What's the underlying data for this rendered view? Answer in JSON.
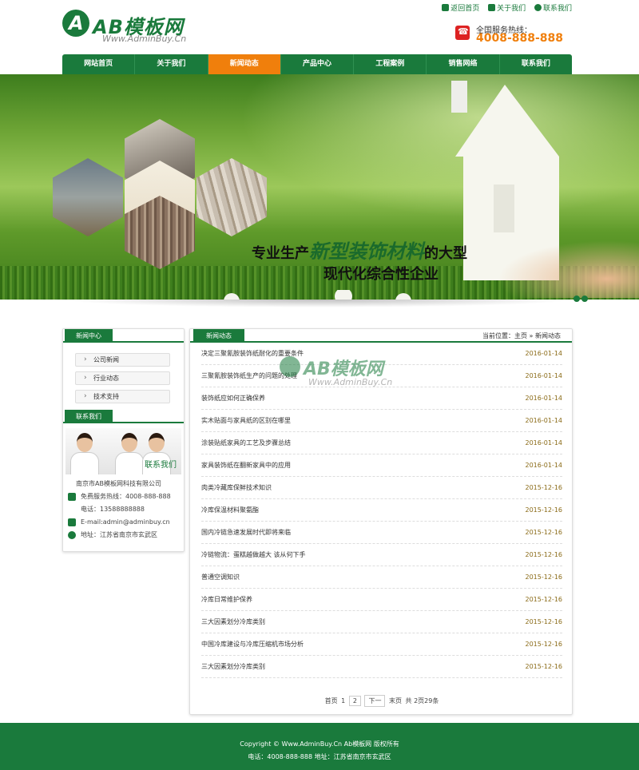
{
  "logo": {
    "name": "AB模板网",
    "url": "Www.AdminBuy.Cn",
    "mark": "A"
  },
  "toplinks": [
    {
      "label": "返回首页",
      "icon": "flag-icon"
    },
    {
      "label": "关于我们",
      "icon": "user-icon"
    },
    {
      "label": "联系我们",
      "icon": "globe-icon"
    }
  ],
  "hotline": {
    "label": "全国服务热线：",
    "number": "4008-888-888"
  },
  "nav": [
    "网站首页",
    "关于我们",
    "新闻动态",
    "产品中心",
    "工程案例",
    "销售网络",
    "联系我们"
  ],
  "nav_active": 2,
  "banner": {
    "slogan_prefix": "专业生产",
    "slogan_highlight": "新型装饰材料",
    "slogan_suffix": "的大型",
    "slogan_line2": "现代化综合性企业"
  },
  "sidebar": {
    "news_title": "新闻中心",
    "categories": [
      "公司新闻",
      "行业动态",
      "技术支持"
    ],
    "contact_title": "联系我们",
    "contact_image_text": "联系我们",
    "company": "南京市AB模板网科技有限公司",
    "phone_free": "免费服务热线：4008-888-888",
    "tel": "电话：13588888888",
    "email": "E-mail:admin@adminbuy.cn",
    "address": "地址：江苏省南京市玄武区"
  },
  "main": {
    "title": "新闻动态",
    "location": "当前位置：主页 » 新闻动态",
    "news": [
      {
        "title": "决定三聚氰胺装饰纸耐化的重要条件",
        "date": "2016-01-14"
      },
      {
        "title": "三聚氰胺装饰纸生产的问题的处理",
        "date": "2016-01-14"
      },
      {
        "title": "装饰纸应如何正确保养",
        "date": "2016-01-14"
      },
      {
        "title": "实木贴面与家具纸的区别在哪里",
        "date": "2016-01-14"
      },
      {
        "title": "涂装贴纸家具的工艺及步骤总结",
        "date": "2016-01-14"
      },
      {
        "title": "家具装饰纸在翻新家具中的应用",
        "date": "2016-01-14"
      },
      {
        "title": "肉类冷藏库保鲜技术知识",
        "date": "2015-12-16"
      },
      {
        "title": "冷库保温材料聚氨酯",
        "date": "2015-12-16"
      },
      {
        "title": "国内冷链急速发展时代即将来临",
        "date": "2015-12-16"
      },
      {
        "title": "冷链物流：蛋糕越做越大 该从何下手",
        "date": "2015-12-16"
      },
      {
        "title": "普通空调知识",
        "date": "2015-12-16"
      },
      {
        "title": "冷库日常维护保养",
        "date": "2015-12-16"
      },
      {
        "title": "三大因素划分冷库类别",
        "date": "2015-12-16"
      },
      {
        "title": "中国冷库建设与冷库压缩机市场分析",
        "date": "2015-12-16"
      },
      {
        "title": "三大因素划分冷库类别",
        "date": "2015-12-16"
      }
    ],
    "pager": {
      "first": "首页",
      "p1": "1",
      "p2": "2",
      "next": "下一",
      "last": "末页",
      "total": "共 2页29条"
    }
  },
  "watermark": {
    "name": "AB模板网",
    "url": "Www.AdminBuy.Cn"
  },
  "footer": {
    "line1": "Copyright © Www.AdminBuy.Cn Ab模板网 版权所有",
    "line2": "电话：4008-888-888   地址：江苏省南京市玄武区"
  },
  "colors": {
    "brand": "#1a7a3c",
    "accent": "#f07f0c",
    "date": "#8a6a16"
  }
}
